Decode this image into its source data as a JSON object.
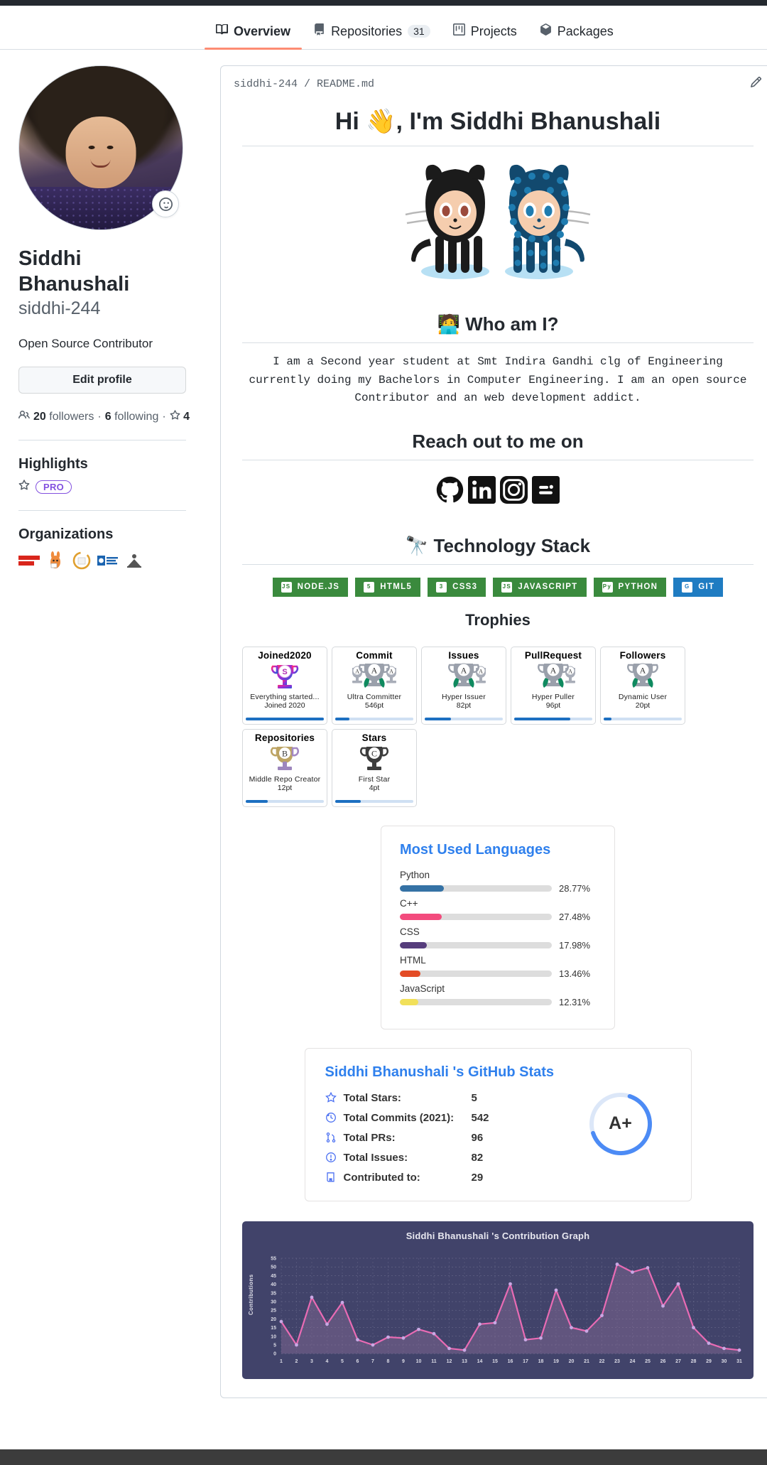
{
  "nav": {
    "tabs": [
      {
        "label": "Overview",
        "icon": "book-icon",
        "count": null,
        "active": true
      },
      {
        "label": "Repositories",
        "icon": "repo-icon",
        "count": "31",
        "active": false
      },
      {
        "label": "Projects",
        "icon": "project-icon",
        "count": null,
        "active": false
      },
      {
        "label": "Packages",
        "icon": "package-icon",
        "count": null,
        "active": false
      }
    ]
  },
  "profile": {
    "name": "Siddhi Bhanushali",
    "username": "siddhi-244",
    "bio": "Open Source Contributor",
    "edit_label": "Edit profile",
    "followers_count": "20",
    "followers_label": "followers",
    "following_count": "6",
    "following_label": "following",
    "stars_count": "4",
    "status_icon": "smiley-icon"
  },
  "highlights": {
    "title": "Highlights",
    "pro_badge": "PRO"
  },
  "organizations": {
    "title": "Organizations",
    "items": [
      {
        "name": "fossasia",
        "text": "FOSS ASIA",
        "bg": "#ffffff",
        "fg": "#d9261c"
      },
      {
        "name": "mascot-org",
        "text": "",
        "bg": "#ffffff",
        "fg": "#e8742b"
      },
      {
        "name": "circle-org",
        "text": "",
        "bg": "#ffffff",
        "fg": "#e0a030"
      },
      {
        "name": "open-code-source",
        "text": "OPEN CODE",
        "bg": "#ffffff",
        "fg": "#1b64b0"
      },
      {
        "name": "grey-org",
        "text": "",
        "bg": "#ffffff",
        "fg": "#555555"
      }
    ]
  },
  "readme": {
    "breadcrumb_user": "siddhi-244",
    "breadcrumb_sep": " / ",
    "breadcrumb_file": "README.md",
    "edit_icon": "pencil-icon",
    "title": "Hi 👋, I'm Siddhi Bhanushali",
    "octocat_alt": "octocat-image",
    "who_heading": "🧑‍💻 Who am I?",
    "who_text": "I am a Second year student at Smt Indira Gandhi clg of Engineering currently doing my Bachelors in Computer Engineering. I am an open source Contributor and an web development addict.",
    "reach_heading": "Reach out to me on",
    "socials": [
      {
        "name": "github-icon",
        "label": "GitHub"
      },
      {
        "name": "linkedin-icon",
        "label": "LinkedIn"
      },
      {
        "name": "instagram-icon",
        "label": "Instagram"
      },
      {
        "name": "blogger-icon",
        "label": "Blogger"
      }
    ],
    "tech_heading": "🔭 Technology Stack",
    "tech_badges": [
      {
        "label": "NODE.JS",
        "color": "#3a8a3d",
        "glyph": "JS",
        "icon": "nodejs-icon"
      },
      {
        "label": "HTML5",
        "color": "#3a8a3d",
        "glyph": "5",
        "icon": "html5-icon"
      },
      {
        "label": "CSS3",
        "color": "#3a8a3d",
        "glyph": "3",
        "icon": "css3-icon"
      },
      {
        "label": "JAVASCRIPT",
        "color": "#3a8a3d",
        "glyph": "JS",
        "icon": "javascript-icon"
      },
      {
        "label": "PYTHON",
        "color": "#3a8a3d",
        "glyph": "Py",
        "icon": "python-icon"
      },
      {
        "label": "GIT",
        "color": "#1f7cc2",
        "glyph": "G",
        "icon": "git-icon"
      }
    ],
    "trophies_heading": "Trophies"
  },
  "trophies": [
    {
      "title": "Joined2020",
      "rank": "S",
      "subtitle": "Everything started...",
      "points": "Joined 2020",
      "progress": 100,
      "color": "#c12bd6"
    },
    {
      "title": "Commit",
      "rank": "A",
      "subtitle": "Ultra Committer",
      "points": "546pt",
      "progress": 18,
      "color": "#9aa0ab"
    },
    {
      "title": "Issues",
      "rank": "A",
      "subtitle": "Hyper Issuer",
      "points": "82pt",
      "progress": 34,
      "color": "#9aa0ab"
    },
    {
      "title": "PullRequest",
      "rank": "A",
      "subtitle": "Hyper Puller",
      "points": "96pt",
      "progress": 72,
      "color": "#9aa0ab"
    },
    {
      "title": "Followers",
      "rank": "A",
      "subtitle": "Dynamic User",
      "points": "20pt",
      "progress": 10,
      "color": "#9aa0ab"
    },
    {
      "title": "Repositories",
      "rank": "B",
      "subtitle": "Middle Repo Creator",
      "points": "12pt",
      "progress": 28,
      "color": "#b99a55"
    },
    {
      "title": "Stars",
      "rank": "C",
      "subtitle": "First Star",
      "points": "4pt",
      "progress": 33,
      "color": "#4a4a4a"
    }
  ],
  "languages_card": {
    "title": "Most Used Languages"
  },
  "stats_card": {
    "title": "Siddhi Bhanushali 's GitHub Stats",
    "rank": "A+",
    "rows": [
      {
        "icon": "star-icon",
        "label": "Total Stars:",
        "value": "5"
      },
      {
        "icon": "history-icon",
        "label": "Total Commits (2021):",
        "value": "542"
      },
      {
        "icon": "pull-request-icon",
        "label": "Total PRs:",
        "value": "96"
      },
      {
        "icon": "issue-icon",
        "label": "Total Issues:",
        "value": "82"
      },
      {
        "icon": "repo-icon",
        "label": "Contributed to:",
        "value": "29"
      }
    ]
  },
  "chart_data": [
    {
      "type": "bar",
      "title": "Most Used Languages",
      "categories": [
        "Python",
        "C++",
        "CSS",
        "HTML",
        "JavaScript"
      ],
      "values": [
        28.77,
        27.48,
        17.98,
        13.46,
        12.31
      ],
      "value_labels": [
        "28.77%",
        "27.48%",
        "17.98%",
        "13.46%",
        "12.31%"
      ],
      "colors": [
        "#3572A5",
        "#f34b7d",
        "#563d7c",
        "#e34c26",
        "#f1e05a"
      ],
      "xlabel": "",
      "ylabel": "",
      "ylim": [
        0,
        100
      ],
      "grid": false,
      "legend": "none",
      "orientation": "horizontal"
    },
    {
      "type": "line",
      "title": "Siddhi Bhanushali 's Contribution Graph",
      "xlabel": "",
      "ylabel": "Contributions",
      "x": [
        1,
        2,
        3,
        4,
        5,
        6,
        7,
        8,
        9,
        10,
        11,
        12,
        13,
        14,
        15,
        16,
        17,
        18,
        19,
        20,
        21,
        22,
        23,
        24,
        25,
        26,
        27,
        28,
        29,
        30,
        31
      ],
      "xticklabels": [
        "1",
        "2",
        "3",
        "4",
        "5",
        "6",
        "7",
        "8",
        "9",
        "10",
        "11",
        "12",
        "13",
        "14",
        "15",
        "16",
        "17",
        "18",
        "19",
        "20",
        "21",
        "22",
        "23",
        "24",
        "25",
        "26",
        "27",
        "28",
        "29",
        "30",
        "31"
      ],
      "yticks": [
        0,
        5,
        10,
        15,
        20,
        25,
        30,
        35,
        40,
        45,
        50,
        55
      ],
      "ylim": [
        0,
        55
      ],
      "grid": true,
      "legend": "none",
      "line_color": "#e96bb4",
      "fill_color": "rgba(180,120,170,0.35)",
      "point_color": "#c8a6e0",
      "background": "#41436a",
      "series": [
        {
          "name": "Contributions",
          "values": [
            18.5,
            5,
            32.5,
            17,
            29.5,
            8,
            5,
            9.5,
            9,
            14,
            11.5,
            3,
            2,
            17,
            17.8,
            40.3,
            8,
            9,
            36.5,
            15,
            13,
            22,
            51.5,
            47,
            49.5,
            27.5,
            40.3,
            15,
            6,
            3,
            2
          ]
        }
      ]
    }
  ]
}
